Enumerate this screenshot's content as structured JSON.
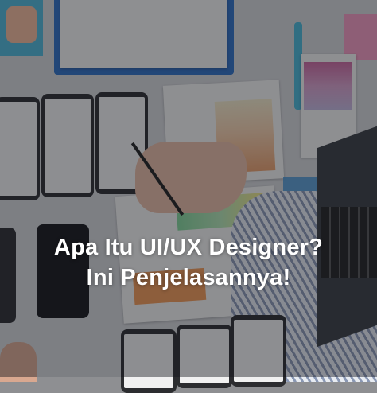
{
  "title": {
    "line1": "Apa Itu UI/UX Designer?",
    "line2": "Ini Penjelasannya!"
  },
  "colors": {
    "overlay": "#14161c",
    "text": "#ffffff",
    "clipboard": "#2f6fc4",
    "pen": "#49b6d6"
  }
}
